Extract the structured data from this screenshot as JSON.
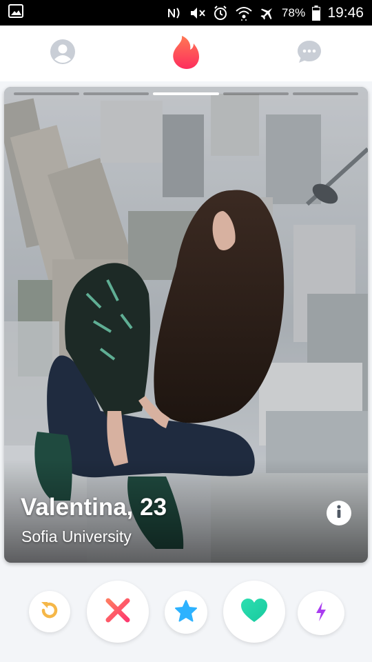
{
  "status_bar": {
    "battery_percent": "78%",
    "time": "19:46",
    "icons": [
      "gallery-icon",
      "nfc-icon",
      "mute-icon",
      "alarm-icon",
      "wifi-icon",
      "airplane-icon",
      "battery-icon"
    ]
  },
  "top_nav": {
    "icons": [
      "profile-icon",
      "tinder-flame-icon",
      "messages-icon"
    ],
    "active_color": "#fd5564",
    "inactive_color": "#c9ced6"
  },
  "card": {
    "name_age": "Valentina, 23",
    "school": "Sofia University",
    "photo_count": 5,
    "active_photo": 3,
    "info_icon": "info-icon"
  },
  "actions": {
    "rewind": {
      "icon": "rewind-icon",
      "color": "#f5b748"
    },
    "nope": {
      "icon": "x-icon",
      "color": "#fd5068"
    },
    "super_like": {
      "icon": "star-icon",
      "color": "#2db2ff"
    },
    "like": {
      "icon": "heart-icon",
      "color": "#22d8a6"
    },
    "boost": {
      "icon": "bolt-icon",
      "color": "#a93cf0"
    }
  }
}
